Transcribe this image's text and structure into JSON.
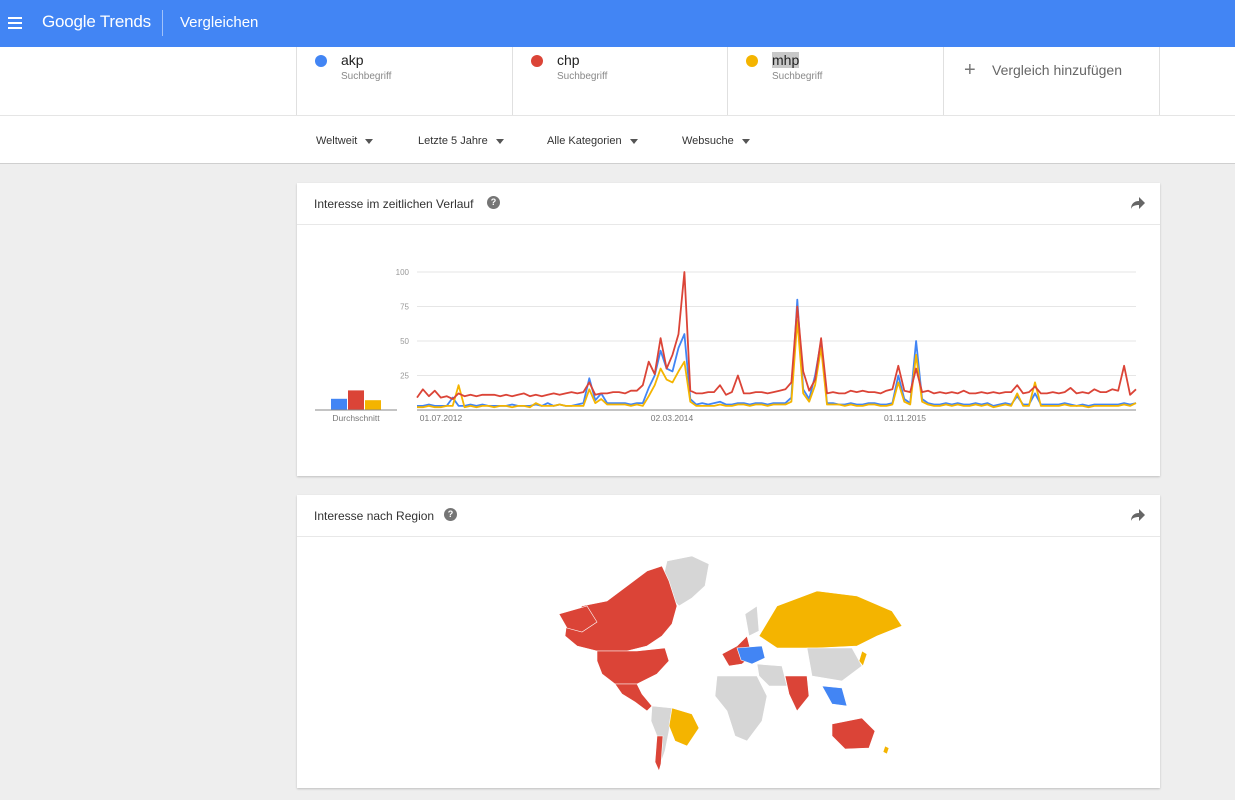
{
  "header": {
    "logo_google": "Google",
    "logo_trends": "Trends",
    "page_title": "Vergleichen"
  },
  "terms": [
    {
      "name": "akp",
      "type": "Suchbegriff",
      "color": "#4285f4"
    },
    {
      "name": "chp",
      "type": "Suchbegriff",
      "color": "#db4437"
    },
    {
      "name": "mhp",
      "type": "Suchbegriff",
      "color": "#f4b400"
    }
  ],
  "add_compare": {
    "icon": "plus-icon",
    "label": "Vergleich hinzufügen"
  },
  "filters": [
    {
      "label": "Weltweit"
    },
    {
      "label": "Letzte 5 Jahre"
    },
    {
      "label": "Alle Kategorien"
    },
    {
      "label": "Websuche"
    }
  ],
  "time_card": {
    "title": "Interesse im zeitlichen Verlauf",
    "average_label": "Durchschnitt",
    "y_ticks": [
      "100",
      "75",
      "50",
      "25"
    ],
    "x_ticks": [
      "01.07.2012",
      "02.03.2014",
      "01.11.2015"
    ]
  },
  "region_card": {
    "title": "Interesse nach Region"
  },
  "chart_data": {
    "type": "line",
    "ylim": [
      0,
      100
    ],
    "y_ticks": [
      25,
      50,
      75,
      100
    ],
    "x_tick_labels": [
      "01.07.2012",
      "02.03.2014",
      "01.11.2015"
    ],
    "averages": {
      "akp": 8,
      "chp": 14,
      "mhp": 7
    },
    "series": [
      {
        "name": "akp",
        "color": "#4285f4",
        "values": [
          3,
          3,
          4,
          3,
          3,
          3,
          9,
          3,
          3,
          4,
          3,
          4,
          3,
          3,
          3,
          3,
          4,
          3,
          3,
          3,
          4,
          3,
          5,
          3,
          4,
          3,
          3,
          4,
          5,
          23,
          7,
          12,
          5,
          5,
          5,
          5,
          4,
          5,
          5,
          16,
          25,
          43,
          30,
          28,
          45,
          55,
          8,
          4,
          5,
          4,
          5,
          6,
          4,
          4,
          5,
          5,
          4,
          5,
          5,
          4,
          5,
          5,
          5,
          9,
          80,
          15,
          8,
          25,
          50,
          5,
          5,
          4,
          4,
          5,
          4,
          4,
          5,
          5,
          4,
          4,
          5,
          25,
          8,
          5,
          50,
          8,
          5,
          4,
          4,
          5,
          4,
          5,
          4,
          4,
          5,
          4,
          5,
          3,
          4,
          5,
          4,
          10,
          4,
          4,
          12,
          4,
          4,
          4,
          4,
          5,
          4,
          3,
          4,
          3,
          4,
          4,
          4,
          4,
          4,
          5,
          4,
          5
        ]
      },
      {
        "name": "chp",
        "color": "#db4437",
        "values": [
          9,
          15,
          10,
          14,
          9,
          10,
          8,
          12,
          10,
          11,
          10,
          11,
          11,
          11,
          10,
          11,
          10,
          11,
          12,
          10,
          11,
          10,
          11,
          12,
          11,
          12,
          13,
          12,
          13,
          20,
          11,
          12,
          12,
          13,
          13,
          12,
          14,
          14,
          18,
          35,
          26,
          52,
          30,
          40,
          55,
          100,
          14,
          12,
          12,
          13,
          13,
          18,
          11,
          13,
          25,
          12,
          12,
          13,
          13,
          12,
          13,
          14,
          15,
          20,
          75,
          28,
          14,
          22,
          52,
          12,
          13,
          12,
          12,
          14,
          13,
          14,
          13,
          13,
          12,
          14,
          15,
          32,
          14,
          13,
          30,
          13,
          14,
          12,
          13,
          12,
          13,
          12,
          14,
          12,
          12,
          13,
          12,
          13,
          12,
          13,
          13,
          18,
          12,
          13,
          17,
          12,
          12,
          13,
          12,
          13,
          16,
          12,
          13,
          12,
          15,
          13,
          13,
          15,
          14,
          32,
          11,
          15
        ]
      },
      {
        "name": "mhp",
        "color": "#f4b400",
        "values": [
          2,
          2,
          3,
          2,
          2,
          3,
          3,
          18,
          2,
          3,
          2,
          3,
          3,
          2,
          3,
          3,
          2,
          3,
          3,
          2,
          5,
          3,
          3,
          3,
          4,
          3,
          3,
          3,
          3,
          15,
          5,
          8,
          4,
          4,
          4,
          4,
          3,
          4,
          3,
          10,
          18,
          30,
          22,
          20,
          28,
          35,
          6,
          3,
          3,
          3,
          3,
          4,
          3,
          3,
          4,
          4,
          3,
          4,
          4,
          3,
          4,
          4,
          4,
          6,
          65,
          12,
          6,
          18,
          45,
          4,
          4,
          4,
          3,
          4,
          3,
          3,
          4,
          4,
          3,
          3,
          4,
          20,
          6,
          4,
          40,
          6,
          4,
          3,
          3,
          4,
          3,
          4,
          3,
          3,
          4,
          3,
          4,
          2,
          3,
          4,
          3,
          12,
          3,
          3,
          20,
          3,
          3,
          3,
          3,
          4,
          3,
          3,
          3,
          2,
          3,
          3,
          3,
          3,
          3,
          4,
          3,
          5
        ]
      }
    ]
  }
}
